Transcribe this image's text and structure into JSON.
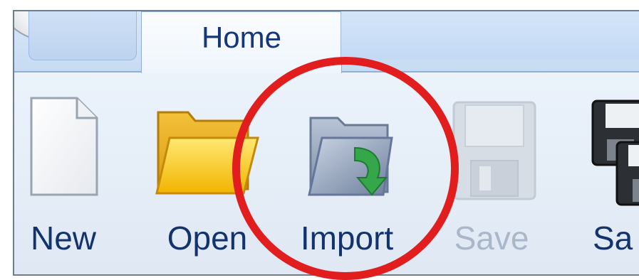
{
  "ribbon": {
    "active_tab": "Home",
    "tools": [
      {
        "label": "New",
        "icon": "new-document-icon",
        "enabled": true
      },
      {
        "label": "Open",
        "icon": "open-folder-icon",
        "enabled": true
      },
      {
        "label": "Import",
        "icon": "import-folder-icon",
        "enabled": true
      },
      {
        "label": "Save",
        "icon": "save-disk-icon",
        "enabled": false
      },
      {
        "label": "Sa",
        "icon": "save-as-disk-icon",
        "enabled": true
      }
    ]
  },
  "annotation": {
    "color": "#e11d1d",
    "target": "Import"
  },
  "colors": {
    "label_text": "#13336e",
    "disabled_text": "#a9b7c9",
    "folder_yellow": "#f6c21a",
    "arrow_green": "#2e9b3e"
  }
}
